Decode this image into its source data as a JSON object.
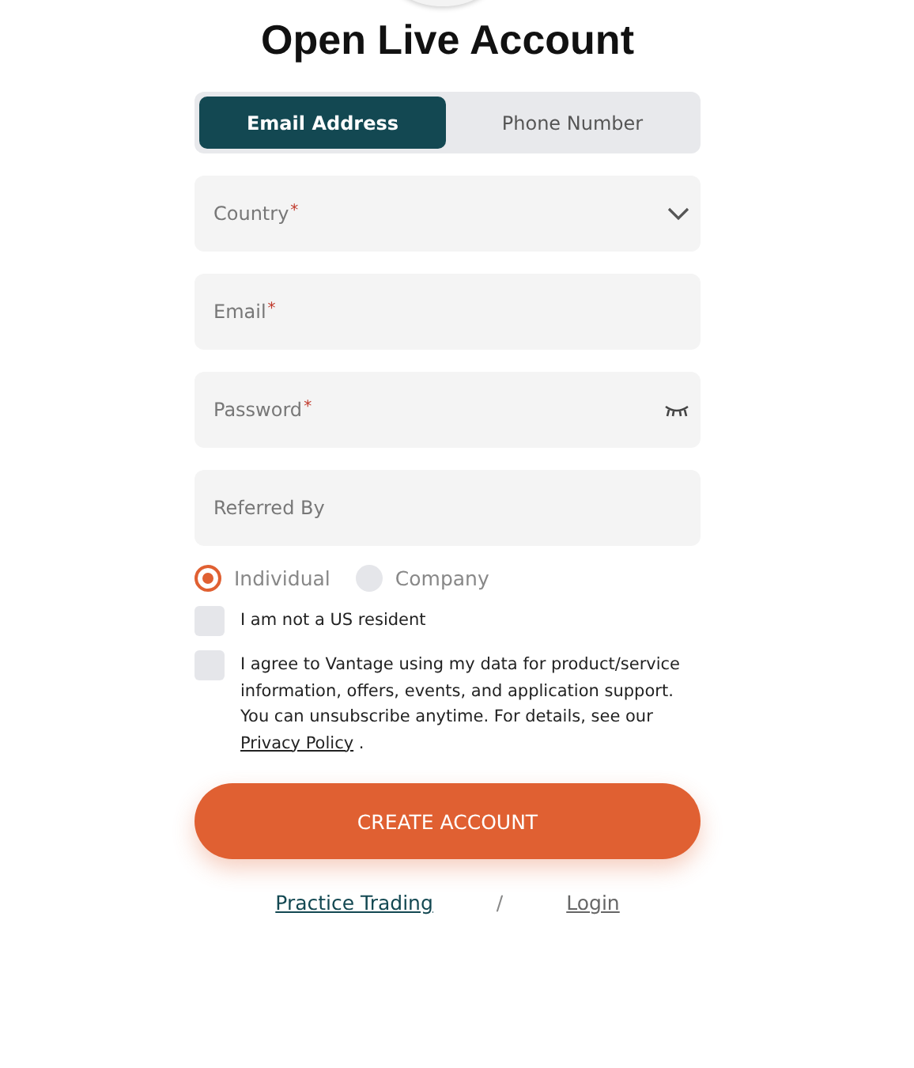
{
  "title": "Open Live Account",
  "tabs": [
    {
      "label": "Email Address",
      "selected": true
    },
    {
      "label": "Phone Number",
      "selected": false
    }
  ],
  "fields": [
    {
      "kind": "select",
      "label": "Country",
      "required_mark": "*"
    },
    {
      "kind": "text",
      "label": "Email",
      "required_mark": "*"
    },
    {
      "kind": "password",
      "label": "Password",
      "required_mark": "*"
    },
    {
      "kind": "text",
      "label": "Referred By"
    }
  ],
  "account_types": [
    {
      "label": "Individual",
      "selected": true
    },
    {
      "label": "Company",
      "selected": false
    }
  ],
  "checkboxes": [
    {
      "text": "I am not a US resident",
      "checked": false
    },
    {
      "text": "I agree to Vantage using my data for product/service information, offers, events, and application support. You can unsubscribe anytime. For details, see our ",
      "link": "Privacy Policy",
      "text_after": " .",
      "checked": false
    }
  ],
  "submit": "CREATE ACCOUNT",
  "links": [
    {
      "label": "Practice Trading",
      "kind": "primary"
    },
    {
      "label": "Login",
      "kind": "secondary"
    }
  ],
  "separator": "/"
}
